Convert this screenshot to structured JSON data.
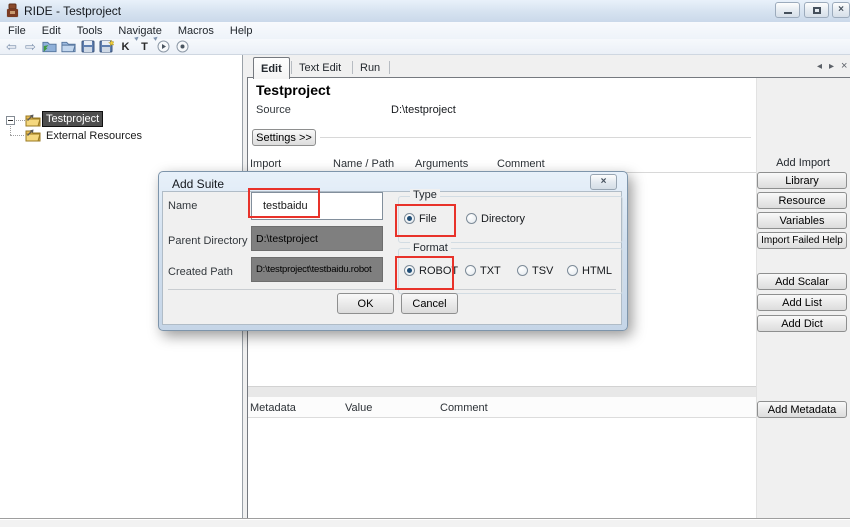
{
  "window": {
    "title": "RIDE - Testproject",
    "close_glyph": "×"
  },
  "menu": {
    "items": [
      "File",
      "Edit",
      "Tools",
      "Navigate",
      "Macros",
      "Help"
    ]
  },
  "toolbar": {
    "back_glyph": "⇦",
    "forward_glyph": "⇨",
    "k_label": "K",
    "t_label": "T",
    "icons": [
      "back-arrow",
      "forward-arrow",
      "open-suite",
      "open-directory",
      "save",
      "save-all",
      "search-keywords",
      "search-tests",
      "run",
      "stop"
    ]
  },
  "tree": {
    "items": [
      {
        "label": "Testproject",
        "selected": true
      },
      {
        "label": "External Resources",
        "selected": false
      }
    ]
  },
  "tabs": {
    "items": [
      {
        "label": "Edit",
        "active": true
      },
      {
        "label": "Text Edit",
        "active": false
      },
      {
        "label": "Run",
        "active": false
      }
    ],
    "nav_left": "◂",
    "nav_right": "▸",
    "nav_close": "×"
  },
  "editor": {
    "title": "Testproject",
    "source_label": "Source",
    "source_value": "D:\\testproject",
    "settings_button": "Settings >>",
    "import_table": {
      "headers": [
        "Import",
        "Name / Path",
        "Arguments",
        "Comment"
      ]
    },
    "metadata_table": {
      "headers": [
        "Metadata",
        "Value",
        "Comment"
      ]
    }
  },
  "actions": {
    "add_import_label": "Add Import",
    "library": "Library",
    "resource": "Resource",
    "variables": "Variables",
    "import_failed_help": "Import Failed Help",
    "add_scalar": "Add Scalar",
    "add_list": "Add List",
    "add_dict": "Add Dict",
    "add_metadata": "Add Metadata"
  },
  "dialog": {
    "title": "Add Suite",
    "close_glyph": "×",
    "name_label": "Name",
    "name_value": "testbaidu",
    "parent_directory_label": "Parent Directory",
    "parent_directory_value": "D:\\testproject",
    "created_path_label": "Created Path",
    "created_path_value": "D:\\testproject\\testbaidu.robot",
    "type_group": {
      "label": "Type",
      "options": [
        {
          "label": "File",
          "selected": true
        },
        {
          "label": "Directory",
          "selected": false
        }
      ]
    },
    "format_group": {
      "label": "Format",
      "options": [
        {
          "label": "ROBOT",
          "selected": true
        },
        {
          "label": "TXT",
          "selected": false
        },
        {
          "label": "TSV",
          "selected": false
        },
        {
          "label": "HTML",
          "selected": false
        }
      ]
    },
    "ok_button": "OK",
    "cancel_button": "Cancel"
  },
  "colors": {
    "selection_bg": "#4e4e4e",
    "readonly_field_bg": "#7f7f7f",
    "annotation_red": "#e8322a",
    "dialog_frame": "#d2e0ef"
  }
}
